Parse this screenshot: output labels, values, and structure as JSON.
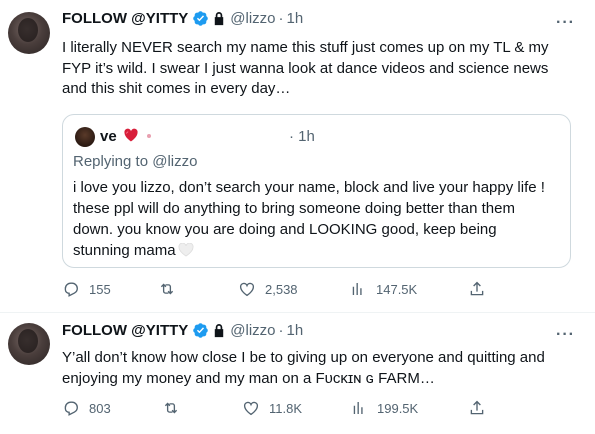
{
  "tweets": [
    {
      "display_name": "FOLLOW @YITTY",
      "handle": "@lizzo",
      "dot": "·",
      "time": "1h",
      "more": "···",
      "lines": [
        "I literally NEVER search my name this stuff just comes up on my TL & my",
        "FYP it’s wild. I swear I just wanna look at dance videos and science news",
        "and this shit comes in every day…"
      ],
      "quote": {
        "name": "ve",
        "dot": "·",
        "time": "1h",
        "replying_prefix": "Replying to ",
        "replying_handle": "@lizzo",
        "lines": [
          "i love you lizzo, don’t search your name, block and live your happy life !",
          "these ppl will do anything to bring someone doing better than them",
          "down. you know you are doing and LOOKING good, keep being",
          "stunning mama"
        ]
      },
      "actions": {
        "replies": "155",
        "reposts": "",
        "likes": "2,538",
        "views": "147.5K"
      }
    },
    {
      "display_name": "FOLLOW @YITTY",
      "handle": "@lizzo",
      "dot": "·",
      "time": "1h",
      "more": "···",
      "lines": [
        "Y’all don’t know how close I be to giving up on everyone and quitting and",
        "enjoying my money and my man on a Fᴜᴄᴋɪɴ ɢ FARM…"
      ],
      "actions": {
        "replies": "803",
        "reposts": "",
        "likes": "11.8K",
        "views": "199.5K"
      }
    }
  ],
  "colors": {
    "text": "#0f1419",
    "secondary": "#536471",
    "border": "#cfd9de",
    "verified": "#1d9bf0"
  },
  "icons": [
    "verified-badge-icon",
    "lock-icon",
    "reply-icon",
    "repost-icon",
    "like-icon",
    "views-icon",
    "share-icon",
    "more-icon",
    "heart-emoji-icon",
    "white-heart-emoji-icon"
  ]
}
